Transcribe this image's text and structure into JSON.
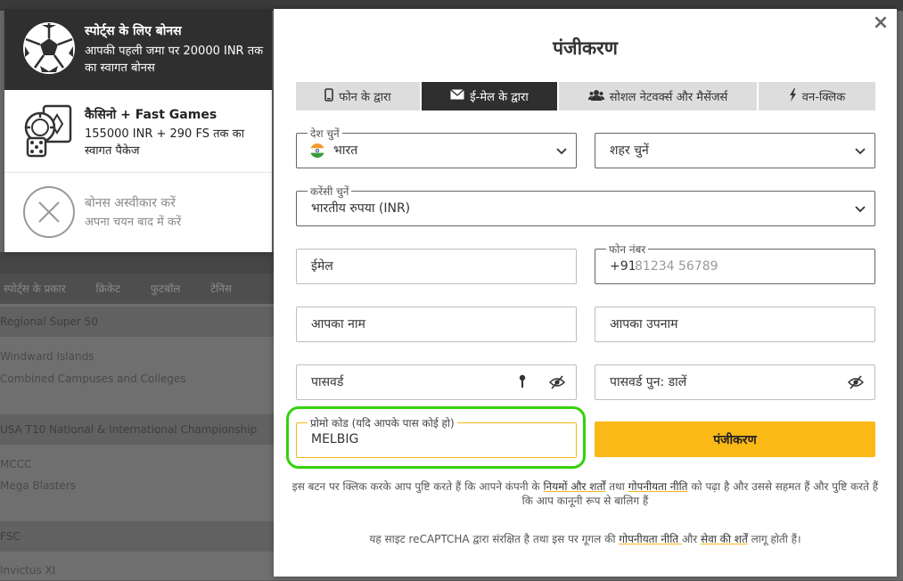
{
  "background": {
    "sports_nav": [
      "स्पोर्ट्स के प्रकार",
      "क्रिकेट",
      "फुटबॉल",
      "टेनिस"
    ],
    "rows": [
      {
        "kind": "header",
        "text": "Regional Super 50"
      },
      {
        "kind": "item",
        "text": "Windward Islands"
      },
      {
        "kind": "item",
        "text": "Combined Campuses and Colleges"
      },
      {
        "kind": "header",
        "text": "USA T10 National & International Championship"
      },
      {
        "kind": "item",
        "text": "MCCC"
      },
      {
        "kind": "item",
        "text": "Mega Blasters"
      },
      {
        "kind": "header",
        "text": "FSC"
      },
      {
        "kind": "item",
        "text": "Invictus XI"
      }
    ]
  },
  "bonus_panel": {
    "sports": {
      "title": "स्पोर्ट्स के लिए बोनस",
      "desc": "आपकी पहली जमा पर 20000 INR तक का स्वागत बोनस",
      "icon": "soccer-ball-icon"
    },
    "casino": {
      "title": "कैसिनो + Fast Games",
      "desc": "155000 INR + 290 FS तक का स्वागत पैकेज",
      "icon": "casino-cards-dice-icon"
    },
    "decline": {
      "title": "बोनस अस्वीकार करें",
      "desc": "अपना चयन बाद में करें",
      "icon": "decline-x-icon"
    }
  },
  "modal": {
    "title": "पंजीकरण",
    "close": "×",
    "tabs": [
      {
        "label": "फोन के द्वारा",
        "icon": "phone-icon"
      },
      {
        "label": "ई-मेल के द्वारा",
        "icon": "envelope-icon"
      },
      {
        "label": "सोशल नेटवर्क्स और मैसेंजर्स",
        "icon": "users-icon"
      },
      {
        "label": "वन-क्लिक",
        "icon": "lightning-icon"
      }
    ],
    "country": {
      "label": "देश चुनें",
      "value": "भारत",
      "flag": "india-flag-icon"
    },
    "city": {
      "placeholder": "शहर चुनें"
    },
    "currency": {
      "label": "करेंसी चुनें",
      "value": "भारतीय रुपया (INR)"
    },
    "email": {
      "placeholder": "ईमेल"
    },
    "phone": {
      "label": "फोन नंबर",
      "code": "+91",
      "placeholder": "81234 56789"
    },
    "first_name": {
      "placeholder": "आपका नाम"
    },
    "last_name": {
      "placeholder": "आपका उपनाम"
    },
    "password": {
      "placeholder": "पासवर्ड"
    },
    "password_repeat": {
      "placeholder": "पासवर्ड पुन: डालें"
    },
    "promo": {
      "label": "प्रोमो कोड (यदि आपके पास कोई हो)",
      "value": "MELBIG"
    },
    "register_button": "पंजीकरण",
    "terms": {
      "part1": "इस बटन पर क्लिक करके आप पुष्टि करते हैं कि आपने कंपनी के ",
      "link1": "नियमों और शर्तों",
      "part2": " तथा ",
      "link2": "गोपनीयता नीति",
      "part3": " को पढ़ा है और उससे सहमत हैं और पुष्टि करते हैं कि आप कानूनी रूप से बालिग हैं"
    },
    "captcha": {
      "part1": "यह साइट reCAPTCHA द्वारा संरक्षित है तथा इस पर गूगल की ",
      "link1": "गोपनीयता नीति ",
      "part2": "और ",
      "link2": "सेवा की शर्तें",
      "part3": " लागू होती हैं।"
    },
    "colors": {
      "accent": "#fbb917",
      "dark": "#2f2f2f",
      "highlight": "#35d10a"
    }
  }
}
